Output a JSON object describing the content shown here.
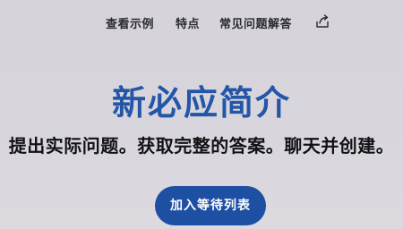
{
  "nav": {
    "items": [
      {
        "label": "查看示例"
      },
      {
        "label": "特点"
      },
      {
        "label": "常见问题解答"
      }
    ],
    "share_icon": "share-icon"
  },
  "hero": {
    "title": "新必应简介",
    "subtitle": "提出实际问题。获取完整的答案。聊天并创建。",
    "cta_label": "加入等待列表"
  },
  "colors": {
    "background": "#d6d4da",
    "title": "#2456a8",
    "cta_background": "#1d4fa3",
    "cta_text": "#ffffff",
    "nav_text": "#2a2a30"
  }
}
